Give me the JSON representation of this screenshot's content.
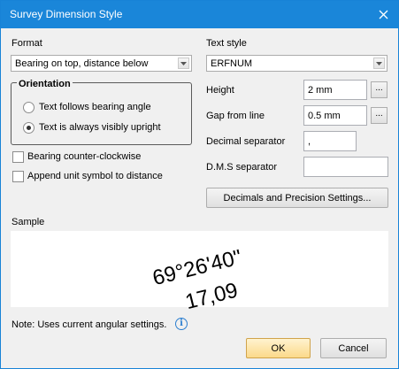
{
  "window": {
    "title": "Survey Dimension Style"
  },
  "format": {
    "label": "Format",
    "value": "Bearing on top, distance below"
  },
  "orientation": {
    "legend": "Orientation",
    "options": [
      {
        "label": "Text follows bearing angle",
        "selected": false
      },
      {
        "label": "Text is always visibly upright",
        "selected": true
      }
    ]
  },
  "checkboxes": {
    "ccw": {
      "label": "Bearing counter-clockwise",
      "checked": false
    },
    "unit": {
      "label": "Append unit symbol to distance",
      "checked": false
    }
  },
  "text_style": {
    "label": "Text style",
    "value": "ERFNUM"
  },
  "height": {
    "label": "Height",
    "value": "2 mm"
  },
  "gap": {
    "label": "Gap from line",
    "value": "0.5 mm"
  },
  "decimal": {
    "label": "Decimal separator",
    "value": ","
  },
  "dms": {
    "label": "D.M.S separator",
    "value": ""
  },
  "decimals_button": "Decimals and Precision Settings...",
  "sample": {
    "label": "Sample",
    "bearing": "69°26'40\"",
    "distance": "17,09"
  },
  "note": "Note: Uses current angular settings.",
  "buttons": {
    "ok": "OK",
    "cancel": "Cancel"
  },
  "icons": {
    "close": "close-icon",
    "dropdown": "chevron-down-icon",
    "info": "info-icon"
  },
  "colors": {
    "titlebar": "#1a86d9",
    "ok_button": "#fbd98a",
    "info_icon": "#2c7fd0"
  }
}
